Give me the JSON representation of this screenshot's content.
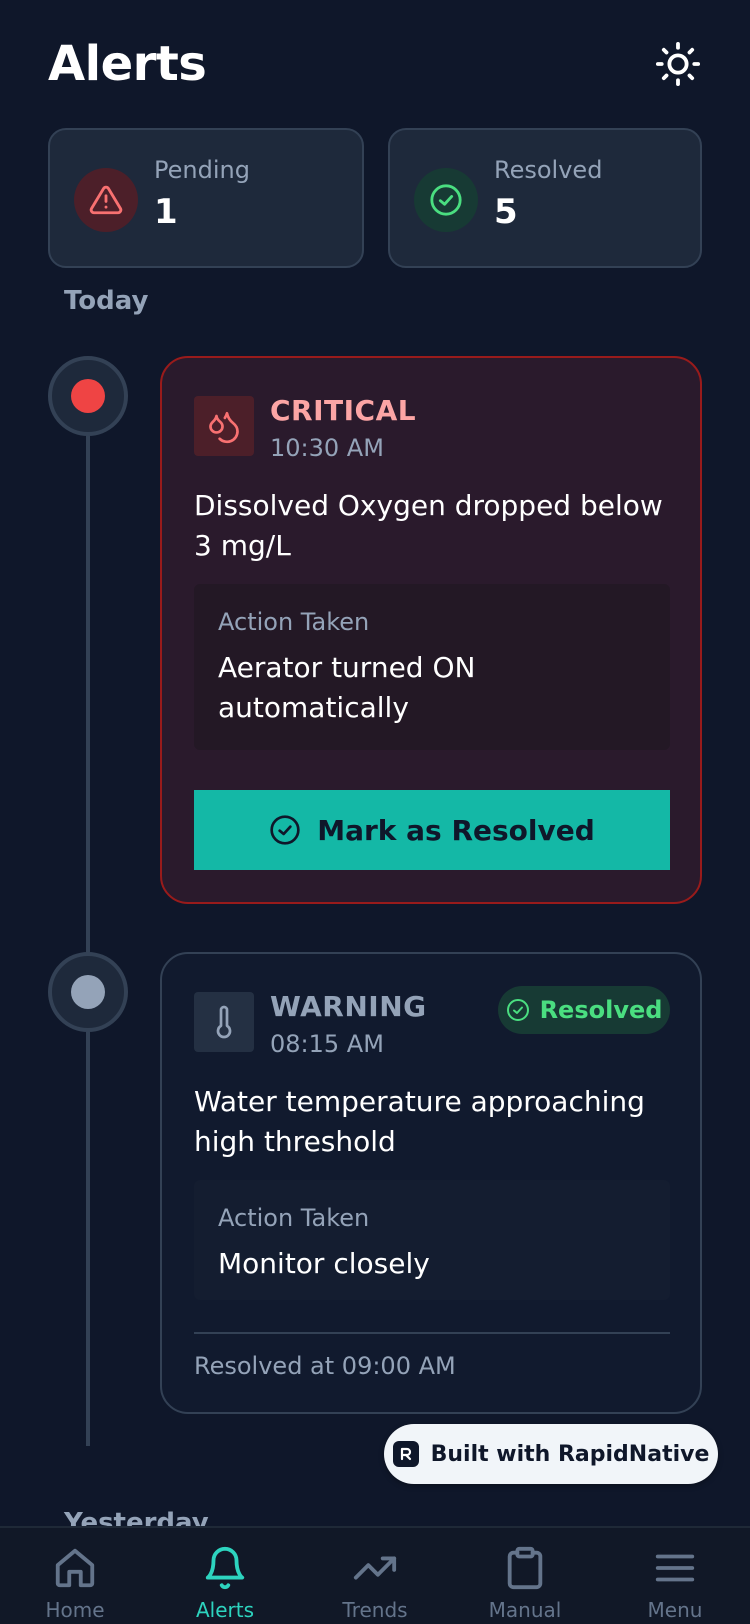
{
  "header": {
    "title": "Alerts",
    "theme_icon": "sun-icon"
  },
  "summary": {
    "pending": {
      "label": "Pending",
      "count": "1",
      "icon": "warning-triangle-icon",
      "color": "#f87171"
    },
    "resolved": {
      "label": "Resolved",
      "count": "5",
      "icon": "check-circle-icon",
      "color": "#4ade80"
    }
  },
  "sections": {
    "today": "Today",
    "yesterday": "Yesterday"
  },
  "alerts": [
    {
      "level": "CRITICAL",
      "time": "10:30 AM",
      "icon": "water-drops-icon",
      "message": "Dissolved Oxygen dropped below 3 mg/L",
      "action_label": "Action Taken",
      "action_text": "Aerator turned ON automatically",
      "button_label": "Mark as Resolved",
      "accent": "#ef4444"
    },
    {
      "level": "WARNING",
      "time": "08:15 AM",
      "icon": "thermometer-icon",
      "status": "Resolved",
      "message": "Water temperature approaching high threshold",
      "action_label": "Action Taken",
      "action_text": "Monitor closely",
      "resolved_at": "Resolved at 09:00 AM",
      "accent": "#94a3b8"
    }
  ],
  "badge": {
    "text": "Built with RapidNative"
  },
  "nav": {
    "active": "Alerts",
    "active_color": "#2dd4bf",
    "items": [
      {
        "label": "Home",
        "icon": "home-icon"
      },
      {
        "label": "Alerts",
        "icon": "bell-icon"
      },
      {
        "label": "Trends",
        "icon": "trending-up-icon"
      },
      {
        "label": "Manual",
        "icon": "clipboard-icon"
      },
      {
        "label": "Menu",
        "icon": "menu-icon"
      }
    ]
  }
}
